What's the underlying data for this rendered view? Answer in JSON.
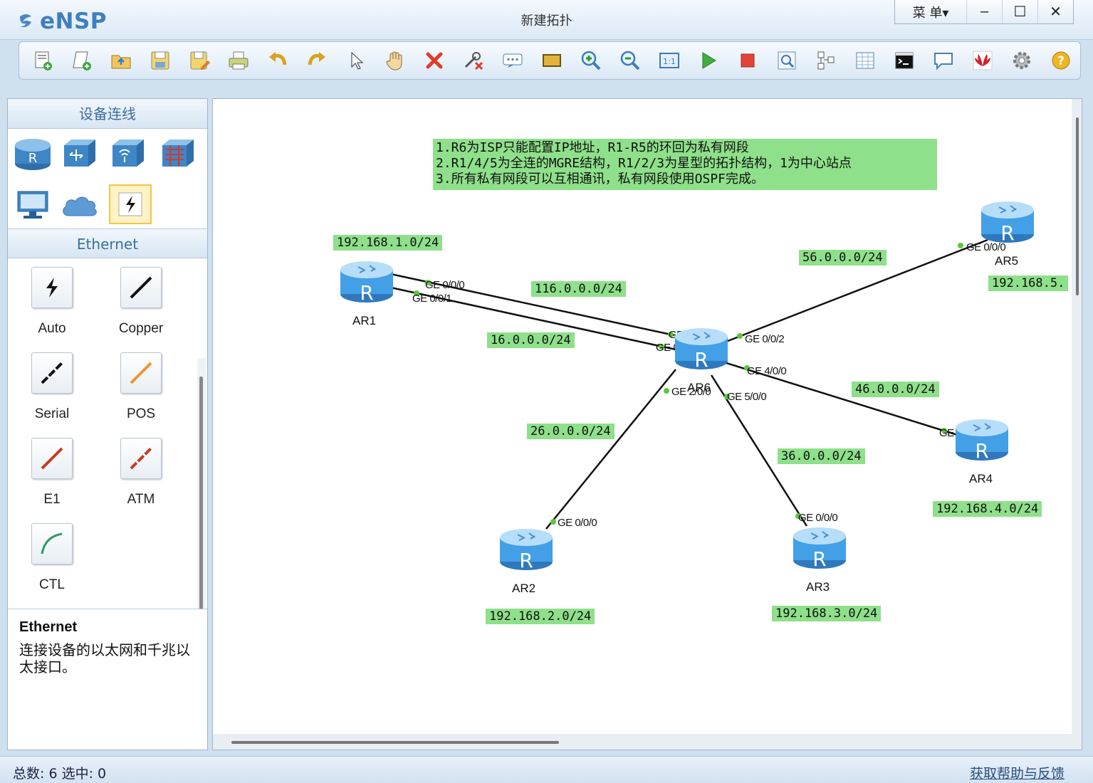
{
  "app": {
    "name": "eNSP",
    "window_title": "新建拓扑"
  },
  "window_controls": {
    "menu_label": "菜 单▾",
    "minimize": "–",
    "maximize": "☐",
    "close": "✕"
  },
  "toolbar": {
    "buttons": [
      "new-topology",
      "new-lab",
      "open",
      "save",
      "save-as",
      "print",
      "undo",
      "redo",
      "select",
      "pan",
      "delete",
      "delete-link",
      "text-label",
      "rectangle",
      "zoom-in",
      "zoom-out",
      "fit-view",
      "start-device",
      "stop-device",
      "capture",
      "topology-view",
      "grid",
      "console",
      "forum",
      "huawei",
      "settings",
      "help"
    ]
  },
  "left_panel": {
    "devices_header": "设备连线",
    "cables_header": "Ethernet",
    "cables": [
      "Auto",
      "Copper",
      "Serial",
      "POS",
      "E1",
      "ATM",
      "CTL"
    ],
    "desc_title": "Ethernet",
    "desc_body": "连接设备的以太网和千兆以太接口。"
  },
  "canvas": {
    "note_lines": [
      "1.R6为ISP只能配置IP地址，R1-R5的环回为私有网段",
      "2.R1/4/5为全连的MGRE结构，R1/2/3为星型的拓扑结构，1为中心站点",
      "3.所有私有网段可以互相通讯，私有网段使用OSPF完成。"
    ],
    "routers": [
      "AR1",
      "AR2",
      "AR3",
      "AR4",
      "AR5",
      "AR6"
    ],
    "networks": {
      "n1": "192.168.1.0/24",
      "n116": "116.0.0.0/24",
      "n16": "16.0.0.0/24",
      "n56": "56.0.0.0/24",
      "n5": "192.168.5.",
      "n46": "46.0.0.0/24",
      "n26": "26.0.0.0/24",
      "n36": "36.0.0.0/24",
      "n4": "192.168.4.0/24",
      "n2": "192.168.2.0/24",
      "n3": "192.168.3.0/24"
    },
    "ports": {
      "ar1_a": "GE 0/0/0",
      "ar1_b": "GE 0/0/1",
      "ar6_a": "GE 0/0/0",
      "ar6_b": "GE 0/0/1",
      "ar6_c": "GE 0/0/2",
      "ar6_d": "GE 4/0/0",
      "ar6_e": "GE 2/0/0",
      "ar6_f": "GE 5/0/0",
      "ar5": "GE 0/0/0",
      "ar4": "GE 0/0/0",
      "ar2": "GE 0/0/0",
      "ar3": "GE 0/0/0"
    },
    "link_color": "#111111",
    "note_color": "#8ee08a"
  },
  "status": {
    "left": "总数: 6  选中: 0",
    "right": "获取帮助与反馈"
  }
}
